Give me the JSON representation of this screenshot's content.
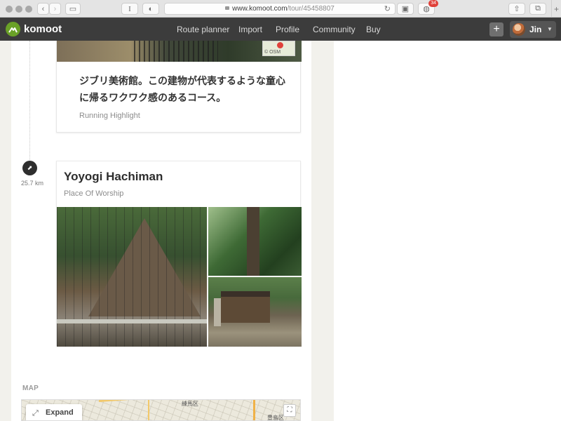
{
  "browser": {
    "url_host": "www.komoot.com",
    "url_path": "/tour/45458807",
    "reader_label": "I",
    "extension_badge": "34",
    "new_tab": "+"
  },
  "nav": {
    "brand": "komoot",
    "links": [
      "Route planner",
      "Import",
      "Profile",
      "Community",
      "Buy"
    ],
    "add_label": "+",
    "user_name": "Jin"
  },
  "highlights": [
    {
      "text": "ジブリ美術館。この建物が代表するような童心に帰るワクワク感のあるコース。",
      "type": "Running Highlight",
      "map_attribution": "© OSM"
    },
    {
      "distance": "25.7 km",
      "title": "Yoyogi Hachiman",
      "type": "Place Of Worship"
    }
  ],
  "map": {
    "heading": "MAP",
    "expand_label": "Expand",
    "label_1": "練馬区",
    "label_2": "豊島区"
  },
  "colors": {
    "nav_bg": "#3c3c3c",
    "brand_green": "#6aa127",
    "badge_red": "#e0413a"
  },
  "icons": [
    "back-icon",
    "forward-icon",
    "sidebar-icon",
    "share-icon",
    "tabs-icon",
    "reload-icon",
    "lock-icon",
    "route-marker-icon",
    "expand-icon",
    "fullscreen-icon",
    "plus-icon",
    "chevron-down-icon"
  ]
}
